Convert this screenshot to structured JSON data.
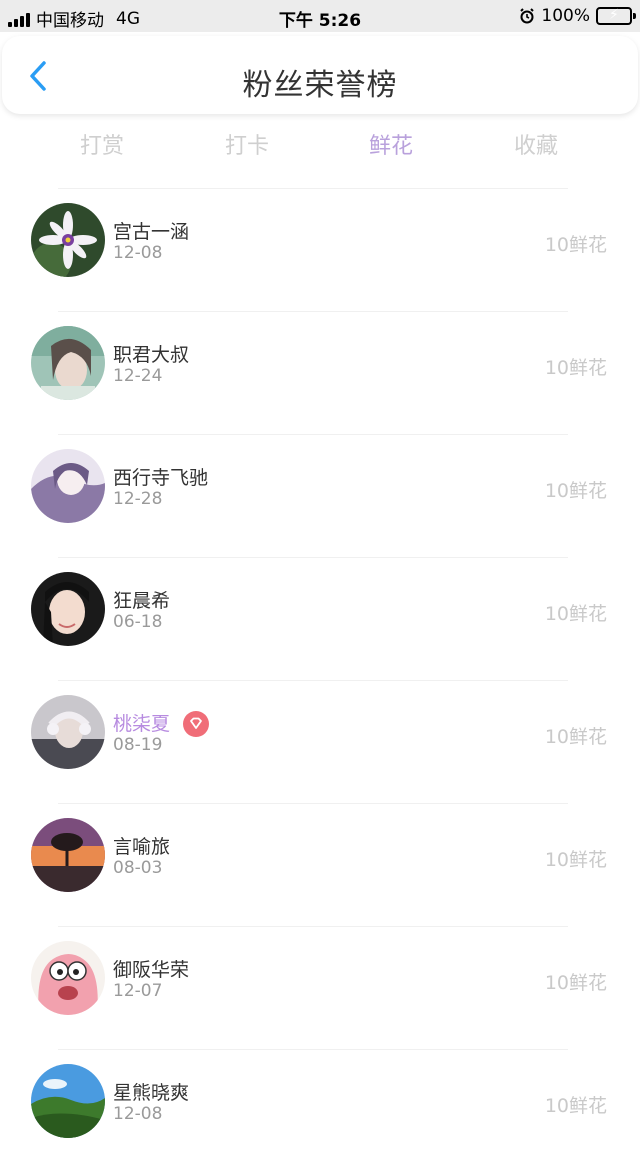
{
  "status_bar": {
    "carrier": "中国移动",
    "network": "4G",
    "time": "下午 5:26",
    "battery": "100%"
  },
  "header": {
    "title": "粉丝荣誉榜",
    "back_icon": "chevron-left-icon"
  },
  "tabs": [
    {
      "label": "打赏"
    },
    {
      "label": "打卡"
    },
    {
      "label": "鲜花"
    },
    {
      "label": "收藏"
    }
  ],
  "active_tab": "鲜花",
  "colors": {
    "accent": "#b9a1dc",
    "back_icon": "#2a9df4",
    "vip_badge": "#f06d78"
  },
  "fans": [
    {
      "name": "宫古一涵",
      "date": "12-08",
      "amount": "10鲜花"
    },
    {
      "name": "职君大叔",
      "date": "12-24",
      "amount": "10鲜花"
    },
    {
      "name": "西行寺飞驰",
      "date": "12-28",
      "amount": "10鲜花"
    },
    {
      "name": "狂晨希",
      "date": "06-18",
      "amount": "10鲜花"
    },
    {
      "name": "桃柒夏",
      "date": "08-19",
      "amount": "10鲜花",
      "vip": true
    },
    {
      "name": "言喻旅",
      "date": "08-03",
      "amount": "10鲜花"
    },
    {
      "name": "御阪华荣",
      "date": "12-07",
      "amount": "10鲜花"
    },
    {
      "name": "星熊晓爽",
      "date": "12-08",
      "amount": "10鲜花"
    }
  ]
}
